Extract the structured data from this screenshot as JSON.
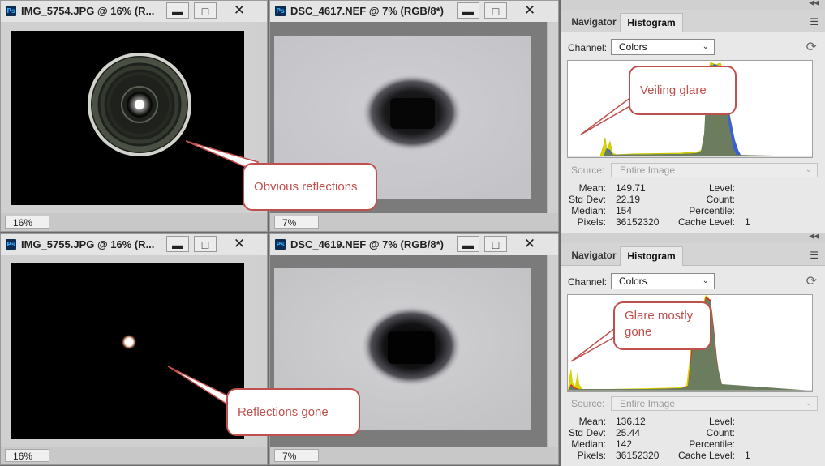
{
  "windows": [
    {
      "title": "IMG_5754.JPG @ 16% (R...",
      "zoom": "16%"
    },
    {
      "title": "DSC_4617.NEF @ 7% (RGB/8*)",
      "zoom": "7%"
    },
    {
      "title": "IMG_5755.JPG @ 16% (R...",
      "zoom": "16%"
    },
    {
      "title": "DSC_4619.NEF @ 7% (RGB/8*)",
      "zoom": "7%"
    }
  ],
  "window_buttons": {
    "minimize": "▬",
    "maximize": "□",
    "close": "✕"
  },
  "panels": [
    {
      "tabs": [
        "Navigator",
        "Histogram"
      ],
      "active_tab": "Histogram",
      "channel_label": "Channel:",
      "channel_value": "Colors",
      "source_label": "Source:",
      "source_value": "Entire Image",
      "stats_left": [
        {
          "label": "Mean:",
          "value": "149.71"
        },
        {
          "label": "Std Dev:",
          "value": "22.19"
        },
        {
          "label": "Median:",
          "value": "154"
        },
        {
          "label": "Pixels:",
          "value": "36152320"
        }
      ],
      "stats_right": [
        {
          "label": "Level:",
          "value": ""
        },
        {
          "label": "Count:",
          "value": ""
        },
        {
          "label": "Percentile:",
          "value": ""
        },
        {
          "label": "Cache Level:",
          "value": "1"
        }
      ]
    },
    {
      "tabs": [
        "Navigator",
        "Histogram"
      ],
      "active_tab": "Histogram",
      "channel_label": "Channel:",
      "channel_value": "Colors",
      "source_label": "Source:",
      "source_value": "Entire Image",
      "stats_left": [
        {
          "label": "Mean:",
          "value": "136.12"
        },
        {
          "label": "Std Dev:",
          "value": "25.44"
        },
        {
          "label": "Median:",
          "value": "142"
        },
        {
          "label": "Pixels:",
          "value": "36152320"
        }
      ],
      "stats_right": [
        {
          "label": "Level:",
          "value": ""
        },
        {
          "label": "Count:",
          "value": ""
        },
        {
          "label": "Percentile:",
          "value": ""
        },
        {
          "label": "Cache Level:",
          "value": "1"
        }
      ]
    }
  ],
  "callouts": {
    "obvious_reflections": "Obvious reflections",
    "reflections_gone": "Reflections gone",
    "veiling_glare": "Veiling glare",
    "glare_mostly_gone": "Glare mostly gone"
  },
  "colors": {
    "callout": "#c0504d",
    "histogram_fill": "#6b7d5e"
  },
  "icons": {
    "panel_collapse": "double-chevron-icon",
    "panel_menu": "hamburger-icon",
    "refresh": "refresh-icon",
    "dropdown": "chevron-down-icon",
    "app": "photoshop-icon"
  }
}
